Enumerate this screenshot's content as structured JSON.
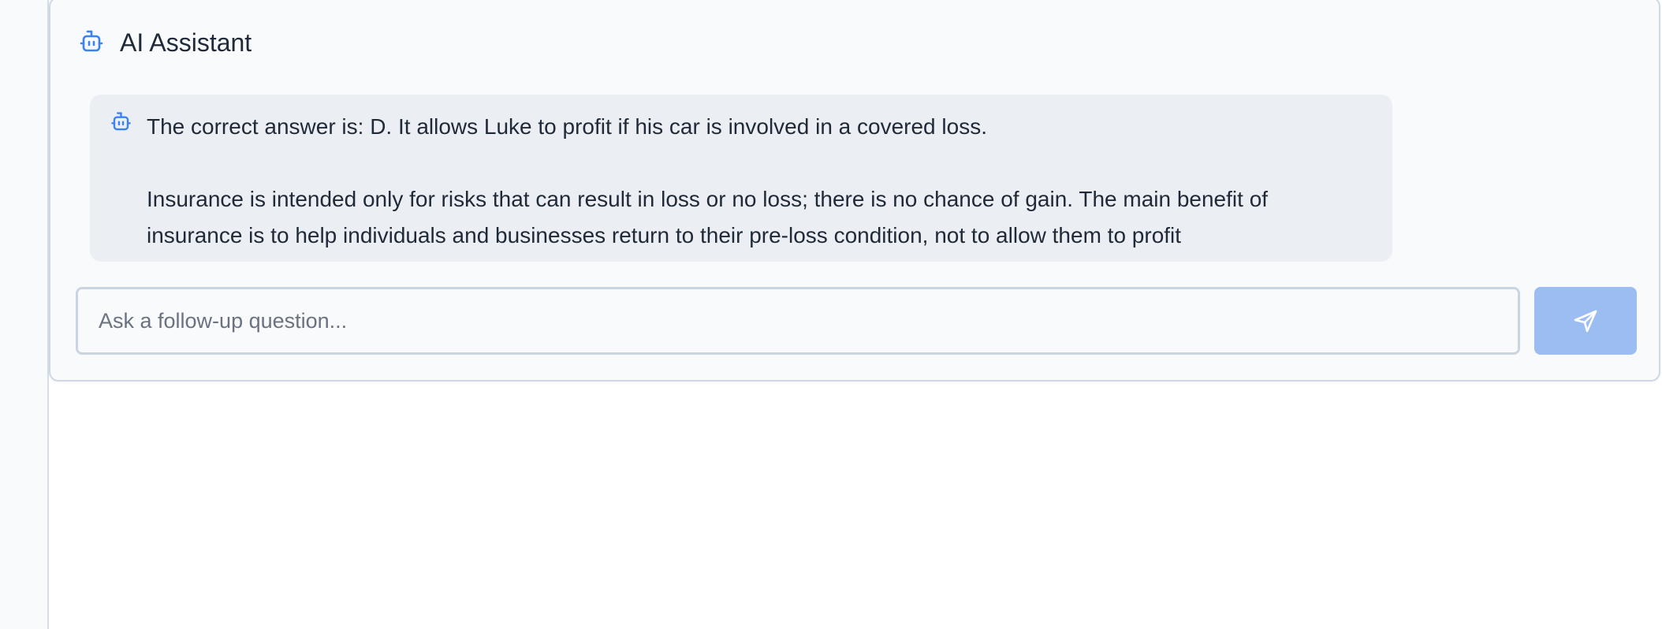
{
  "assistant": {
    "title": "AI Assistant",
    "header_icon": "robot-icon",
    "colors": {
      "accent": "#3b82f6",
      "panel_bg": "#f8fafc",
      "bubble_bg": "#ebeff3",
      "send_button_bg": "#9bbdf2"
    }
  },
  "message": {
    "icon": "robot-icon",
    "lines": [
      "The correct answer is: D. It allows Luke to profit if his car is involved in a covered loss.",
      "",
      "Insurance is intended only for risks that can result in loss or no loss; there is no chance of gain. The main benefit of",
      "insurance is to help individuals and businesses return to their pre-loss condition, not to allow them to profit"
    ]
  },
  "composer": {
    "value": "",
    "placeholder": "Ask a follow-up question...",
    "send_icon": "send-icon"
  }
}
